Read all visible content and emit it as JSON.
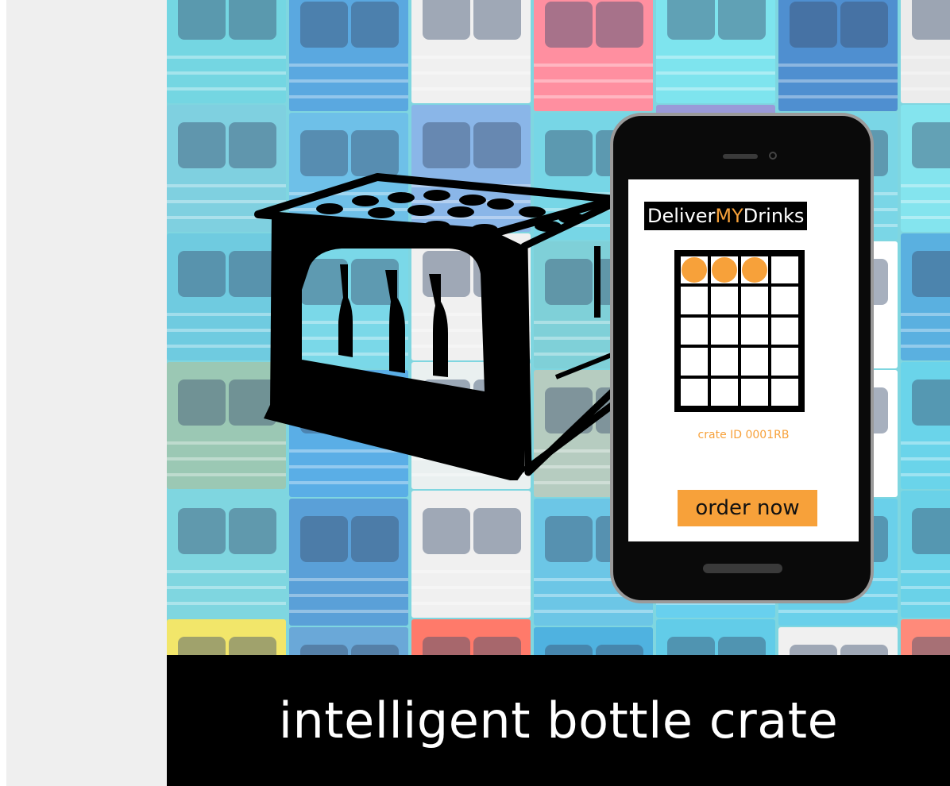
{
  "caption": "intelligent bottle crate",
  "app": {
    "title_pre": "Deliver",
    "title_mid": "MY",
    "title_post": "Drinks",
    "crate_id": "crate ID 0001RB",
    "order_label": "order now",
    "grid": {
      "rows": 5,
      "cols": 4,
      "filled_slots": [
        0,
        1,
        2
      ]
    }
  },
  "colors": {
    "accent": "#f7a13a",
    "caption_bar": "#000000",
    "left_panel": "#efefef"
  },
  "background": {
    "columns": [
      [
        "#74d6e2",
        "#7fd0e0",
        "#6fcbe0",
        "#9bc8b4",
        "#7fd6e0",
        "#f2e66a"
      ],
      [
        "#5aa8e0",
        "#6ec0e8",
        "#7ad8e8",
        "#5aaee6",
        "#5aa0d8",
        "#6aa8d8"
      ],
      [
        "#f0f0f0",
        "#8ab6e8",
        "#f0f0f0",
        "#eaf0f0",
        "#f0f0f0",
        "#ff7a6a"
      ],
      [
        "#ff8fa0",
        "#77d6e6",
        "#7fd0d8",
        "#b6ccc0",
        "#6cc6e6",
        "#4fb2e0"
      ],
      [
        "#7ee4ee",
        "#9a9ad8",
        "#d8d4cc",
        "#e4e4e4",
        "#68d0ee",
        "#62cce8"
      ],
      [
        "#4f8fd0",
        "#7ad6e6",
        "#ffffff",
        "#ffffff",
        "#6ad0ea",
        "#f0f0f0"
      ],
      [
        "#ececec",
        "#84e4ee",
        "#5ab0e0",
        "#6ad4ea",
        "#6ad2e8",
        "#ff8a7a"
      ]
    ]
  }
}
